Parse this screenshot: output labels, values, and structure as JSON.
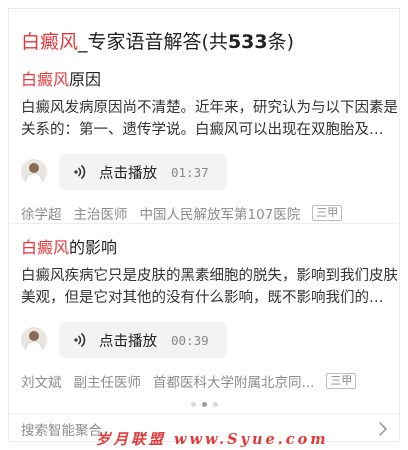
{
  "header": {
    "keyword": "白癜风",
    "rest": "_专家语音解答(共",
    "count": "533",
    "suffix": "条)"
  },
  "items": [
    {
      "title_keyword": "白癜风",
      "title_rest": "原因",
      "desc_line1": "白癜风发病原因尚不清楚。近年来，研究认为与以下因素是有",
      "desc_line2": "关系的：第一、遗传学说。白癜风可以出现在双胞胎及家族...",
      "play_label": "点击播放",
      "duration": "01:37",
      "doctor": "徐学超",
      "title": "主治医师",
      "hospital": "中国人民解放军第107医院",
      "badge": "三甲"
    },
    {
      "title_keyword": "白癜风",
      "title_rest": "的影响",
      "desc_line1": "白癜风疾病它只是皮肤的黑素细胞的脱失，影响到我们皮肤的",
      "desc_line2": "美观，但是它对其他的没有什么影响，既不影响我们的寿命...",
      "play_label": "点击播放",
      "duration": "00:39",
      "doctor": "刘文斌",
      "title": "副主任医师",
      "hospital": "首都医科大学附属北京同...",
      "badge": "三甲"
    }
  ],
  "pagination": {
    "count": 3,
    "active": 1
  },
  "footer": {
    "label": "搜索智能聚合"
  },
  "watermark": "岁月联盟 www.Syue.com",
  "colors": {
    "keyword": "#e3393c",
    "text": "#222222",
    "muted": "#8c8c8c",
    "pill_bg": "#f3f3f3"
  },
  "icons": [
    "speaker-icon",
    "doctor-avatar",
    "chevron-right-icon"
  ]
}
